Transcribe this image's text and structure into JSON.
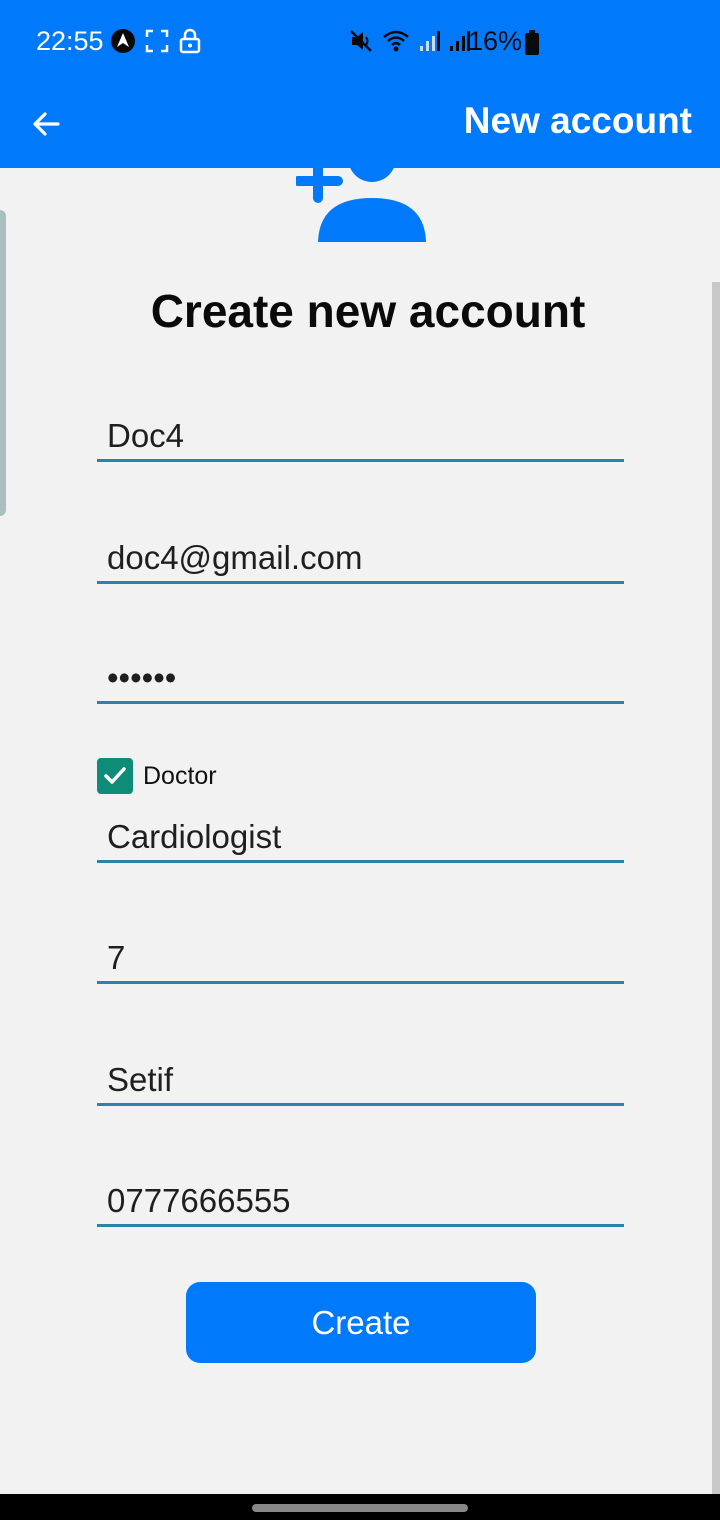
{
  "status_bar": {
    "time": "22:55",
    "battery_text": "16%",
    "icons": [
      "navigation-icon",
      "screenshot-icon",
      "lock-icon",
      "mute-icon",
      "wifi-icon",
      "signal-icon",
      "signal-icon",
      "battery-icon"
    ]
  },
  "app_bar": {
    "title": "New account",
    "back_icon": "arrow-back-icon"
  },
  "main": {
    "title": "Create new account",
    "fields": {
      "name": "Doc4",
      "email": "doc4@gmail.com",
      "password": "••••••",
      "specialty": "Cardiologist",
      "experience": "7",
      "city": "Setif",
      "phone": "0777666555"
    },
    "doctor_checkbox": {
      "label": "Doctor",
      "checked": true
    },
    "create_button": "Create"
  },
  "colors": {
    "primary": "#0079fb",
    "field_underline": "#2d82a8",
    "checkbox": "#0f8c78",
    "background": "#f2f2f2"
  }
}
